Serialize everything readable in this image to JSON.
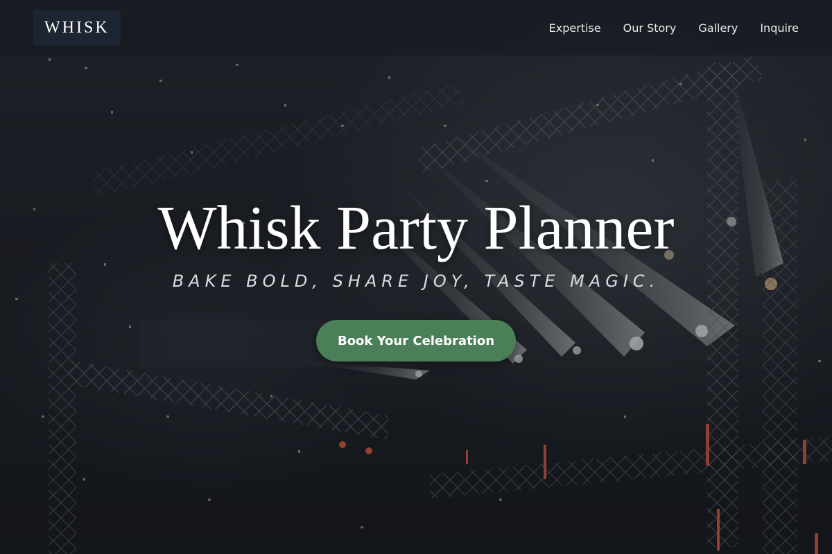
{
  "brand": {
    "logo_text": "WHISK"
  },
  "nav": {
    "items": [
      {
        "label": "Expertise"
      },
      {
        "label": "Our Story"
      },
      {
        "label": "Gallery"
      },
      {
        "label": "Inquire"
      }
    ]
  },
  "hero": {
    "title": "Whisk Party Planner",
    "tagline": "BAKE BOLD, SHARE JOY, TASTE MAGIC.",
    "cta_label": "Book Your Celebration",
    "background_image": "concert-stage-truss-lights-confetti"
  },
  "colors": {
    "accent": "#4a7f58",
    "nav_background": "#1d2532",
    "page_background": "#15181f"
  }
}
